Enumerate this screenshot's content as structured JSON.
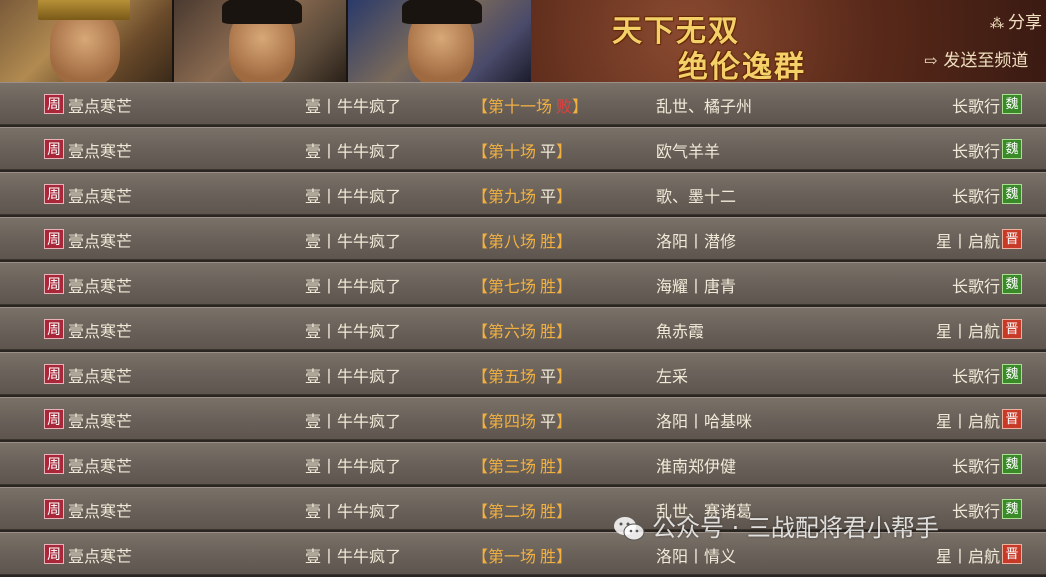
{
  "header": {
    "title_line1": "天下无双",
    "title_line2": "绝伦逸群",
    "share_label": "分享",
    "send_label": "发送至频道"
  },
  "colors": {
    "lose": "#e04040",
    "win": "#f2b040",
    "wei": "#3a8a2a",
    "jin": "#c83a28",
    "zhou": "#a8283a"
  },
  "battles": [
    {
      "badge": "周",
      "player": "壹点寒芒",
      "player_server": "壹丨牛牛疯了",
      "match_label": "【第十一场",
      "result": "败",
      "result_type": "lose",
      "close": "】",
      "opponent": "乱世、橘子州",
      "opp_server": "长歌行",
      "faction": "魏",
      "faction_type": "wei"
    },
    {
      "badge": "周",
      "player": "壹点寒芒",
      "player_server": "壹丨牛牛疯了",
      "match_label": "【第十场",
      "result": "平",
      "result_type": "draw",
      "close": "】",
      "opponent": "欧气羊羊",
      "opp_server": "长歌行",
      "faction": "魏",
      "faction_type": "wei"
    },
    {
      "badge": "周",
      "player": "壹点寒芒",
      "player_server": "壹丨牛牛疯了",
      "match_label": "【第九场",
      "result": "平",
      "result_type": "draw",
      "close": "】",
      "opponent": "歌、墨十二",
      "opp_server": "长歌行",
      "faction": "魏",
      "faction_type": "wei"
    },
    {
      "badge": "周",
      "player": "壹点寒芒",
      "player_server": "壹丨牛牛疯了",
      "match_label": "【第八场",
      "result": "胜",
      "result_type": "win",
      "close": "】",
      "opponent": "洛阳丨潜修",
      "opp_server": "星丨启航",
      "faction": "晋",
      "faction_type": "jin"
    },
    {
      "badge": "周",
      "player": "壹点寒芒",
      "player_server": "壹丨牛牛疯了",
      "match_label": "【第七场",
      "result": "胜",
      "result_type": "win",
      "close": "】",
      "opponent": "海耀丨唐青",
      "opp_server": "长歌行",
      "faction": "魏",
      "faction_type": "wei"
    },
    {
      "badge": "周",
      "player": "壹点寒芒",
      "player_server": "壹丨牛牛疯了",
      "match_label": "【第六场",
      "result": "胜",
      "result_type": "win",
      "close": "】",
      "opponent": "魚赤霞",
      "opp_server": "星丨启航",
      "faction": "晋",
      "faction_type": "jin"
    },
    {
      "badge": "周",
      "player": "壹点寒芒",
      "player_server": "壹丨牛牛疯了",
      "match_label": "【第五场",
      "result": "平",
      "result_type": "draw",
      "close": "】",
      "opponent": "左采",
      "opp_server": "长歌行",
      "faction": "魏",
      "faction_type": "wei"
    },
    {
      "badge": "周",
      "player": "壹点寒芒",
      "player_server": "壹丨牛牛疯了",
      "match_label": "【第四场",
      "result": "平",
      "result_type": "draw",
      "close": "】",
      "opponent": "洛阳丨哈基咪",
      "opp_server": "星丨启航",
      "faction": "晋",
      "faction_type": "jin"
    },
    {
      "badge": "周",
      "player": "壹点寒芒",
      "player_server": "壹丨牛牛疯了",
      "match_label": "【第三场",
      "result": "胜",
      "result_type": "win",
      "close": "】",
      "opponent": "淮南郑伊健",
      "opp_server": "长歌行",
      "faction": "魏",
      "faction_type": "wei"
    },
    {
      "badge": "周",
      "player": "壹点寒芒",
      "player_server": "壹丨牛牛疯了",
      "match_label": "【第二场",
      "result": "胜",
      "result_type": "win",
      "close": "】",
      "opponent": "乱世、赛诸葛",
      "opp_server": "长歌行",
      "faction": "魏",
      "faction_type": "wei"
    },
    {
      "badge": "周",
      "player": "壹点寒芒",
      "player_server": "壹丨牛牛疯了",
      "match_label": "【第一场",
      "result": "胜",
      "result_type": "win",
      "close": "】",
      "opponent": "洛阳丨情义",
      "opp_server": "星丨启航",
      "faction": "晋",
      "faction_type": "jin"
    }
  ],
  "watermark": "公众号 · 三战配将君小帮手"
}
